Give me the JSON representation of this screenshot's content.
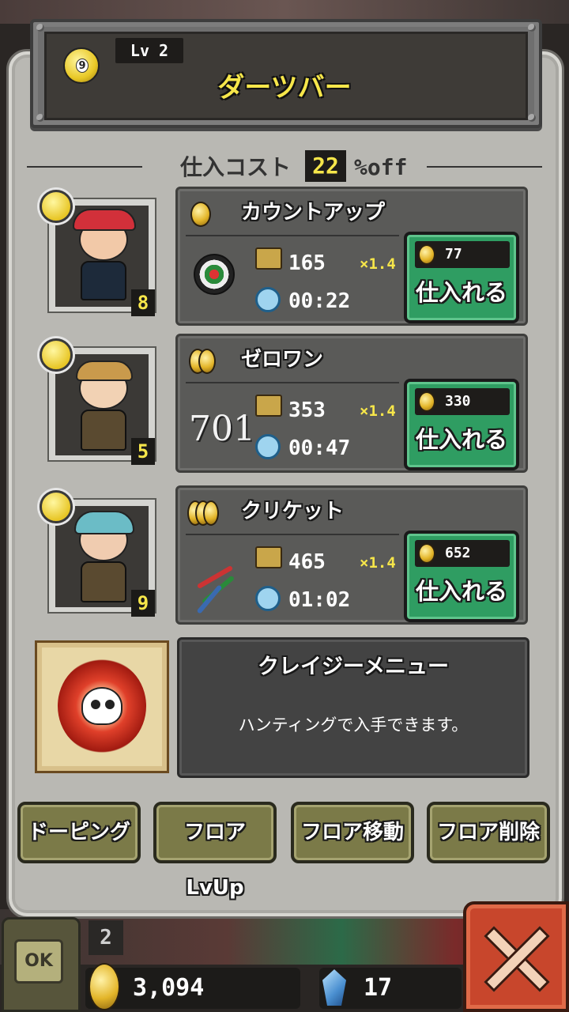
{
  "header": {
    "level_label": "Lv 2",
    "title": "ダーツバー",
    "icon": "eight-ball-icon",
    "ball_number": "9"
  },
  "cost": {
    "label": "仕入コスト",
    "value": "22",
    "suffix": "%off"
  },
  "items": [
    {
      "name": "カウントアップ",
      "stock": "165",
      "time": "00:22",
      "multiplier": "×1.4",
      "price": "77",
      "buy_label": "仕入れる",
      "staff_level": "8",
      "picture": "dartboard-icon"
    },
    {
      "name": "ゼロワン",
      "picture_text": "701",
      "stock": "353",
      "time": "00:47",
      "multiplier": "×1.4",
      "price": "330",
      "buy_label": "仕入れる",
      "staff_level": "5"
    },
    {
      "name": "クリケット",
      "stock": "465",
      "time": "01:02",
      "multiplier": "×1.4",
      "price": "652",
      "buy_label": "仕入れる",
      "staff_level": "9",
      "picture": "darts-icon"
    }
  ],
  "crazy_menu": {
    "title": "クレイジーメニュー",
    "description": "ハンティングで入手できます。"
  },
  "actions": [
    "ドーピング",
    "フロアLvUp",
    "フロア移動",
    "フロア削除"
  ],
  "hud": {
    "ok_label": "OK",
    "floor": "2",
    "coins": "3,094",
    "gems": "17"
  },
  "colors": {
    "accent_yellow": "#f6e64a",
    "buy_green": "#2f9d62",
    "close_red": "#c8462c"
  }
}
